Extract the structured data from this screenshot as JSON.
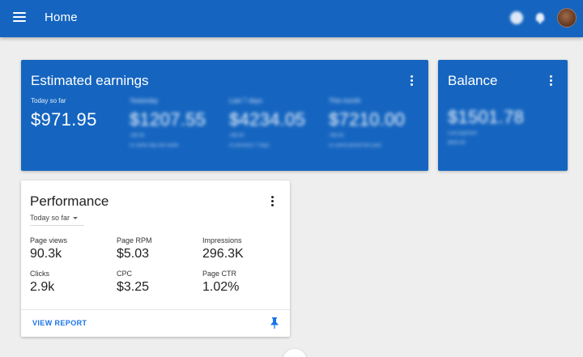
{
  "header": {
    "title": "Home",
    "colors": {
      "bar": "#1565c0",
      "text": "#ffffff"
    },
    "icons": [
      "menu-icon",
      "help-icon",
      "bell-icon",
      "avatar"
    ]
  },
  "earnings": {
    "title": "Estimated earnings",
    "today": {
      "label": "Today so far",
      "value": "$971.95"
    },
    "yesterday": {
      "label": "Yesterday",
      "value": "$1207.55",
      "sub1": "+$0.00",
      "sub2": "vs same day last week"
    },
    "last7": {
      "label": "Last 7 days",
      "value": "$4234.05",
      "sub1": "+$0.00",
      "sub2": "vs previous 7 days"
    },
    "month": {
      "label": "This month",
      "value": "$7210.00",
      "sub1": "+$0.00",
      "sub2": "vs same period last year"
    }
  },
  "balance": {
    "title": "Balance",
    "value": "$1501.78",
    "sub1": "Last payment",
    "sub2": "$000.00"
  },
  "performance": {
    "title": "Performance",
    "range": "Today so far",
    "stats": [
      {
        "label": "Page views",
        "value": "90.3k"
      },
      {
        "label": "Page RPM",
        "value": "$5.03"
      },
      {
        "label": "Impressions",
        "value": "296.3K"
      },
      {
        "label": "Clicks",
        "value": "2.9k"
      },
      {
        "label": "CPC",
        "value": "$3.25"
      },
      {
        "label": "Page CTR",
        "value": "1.02%"
      }
    ],
    "action": "VIEW REPORT",
    "accent": "#1a73e8"
  }
}
